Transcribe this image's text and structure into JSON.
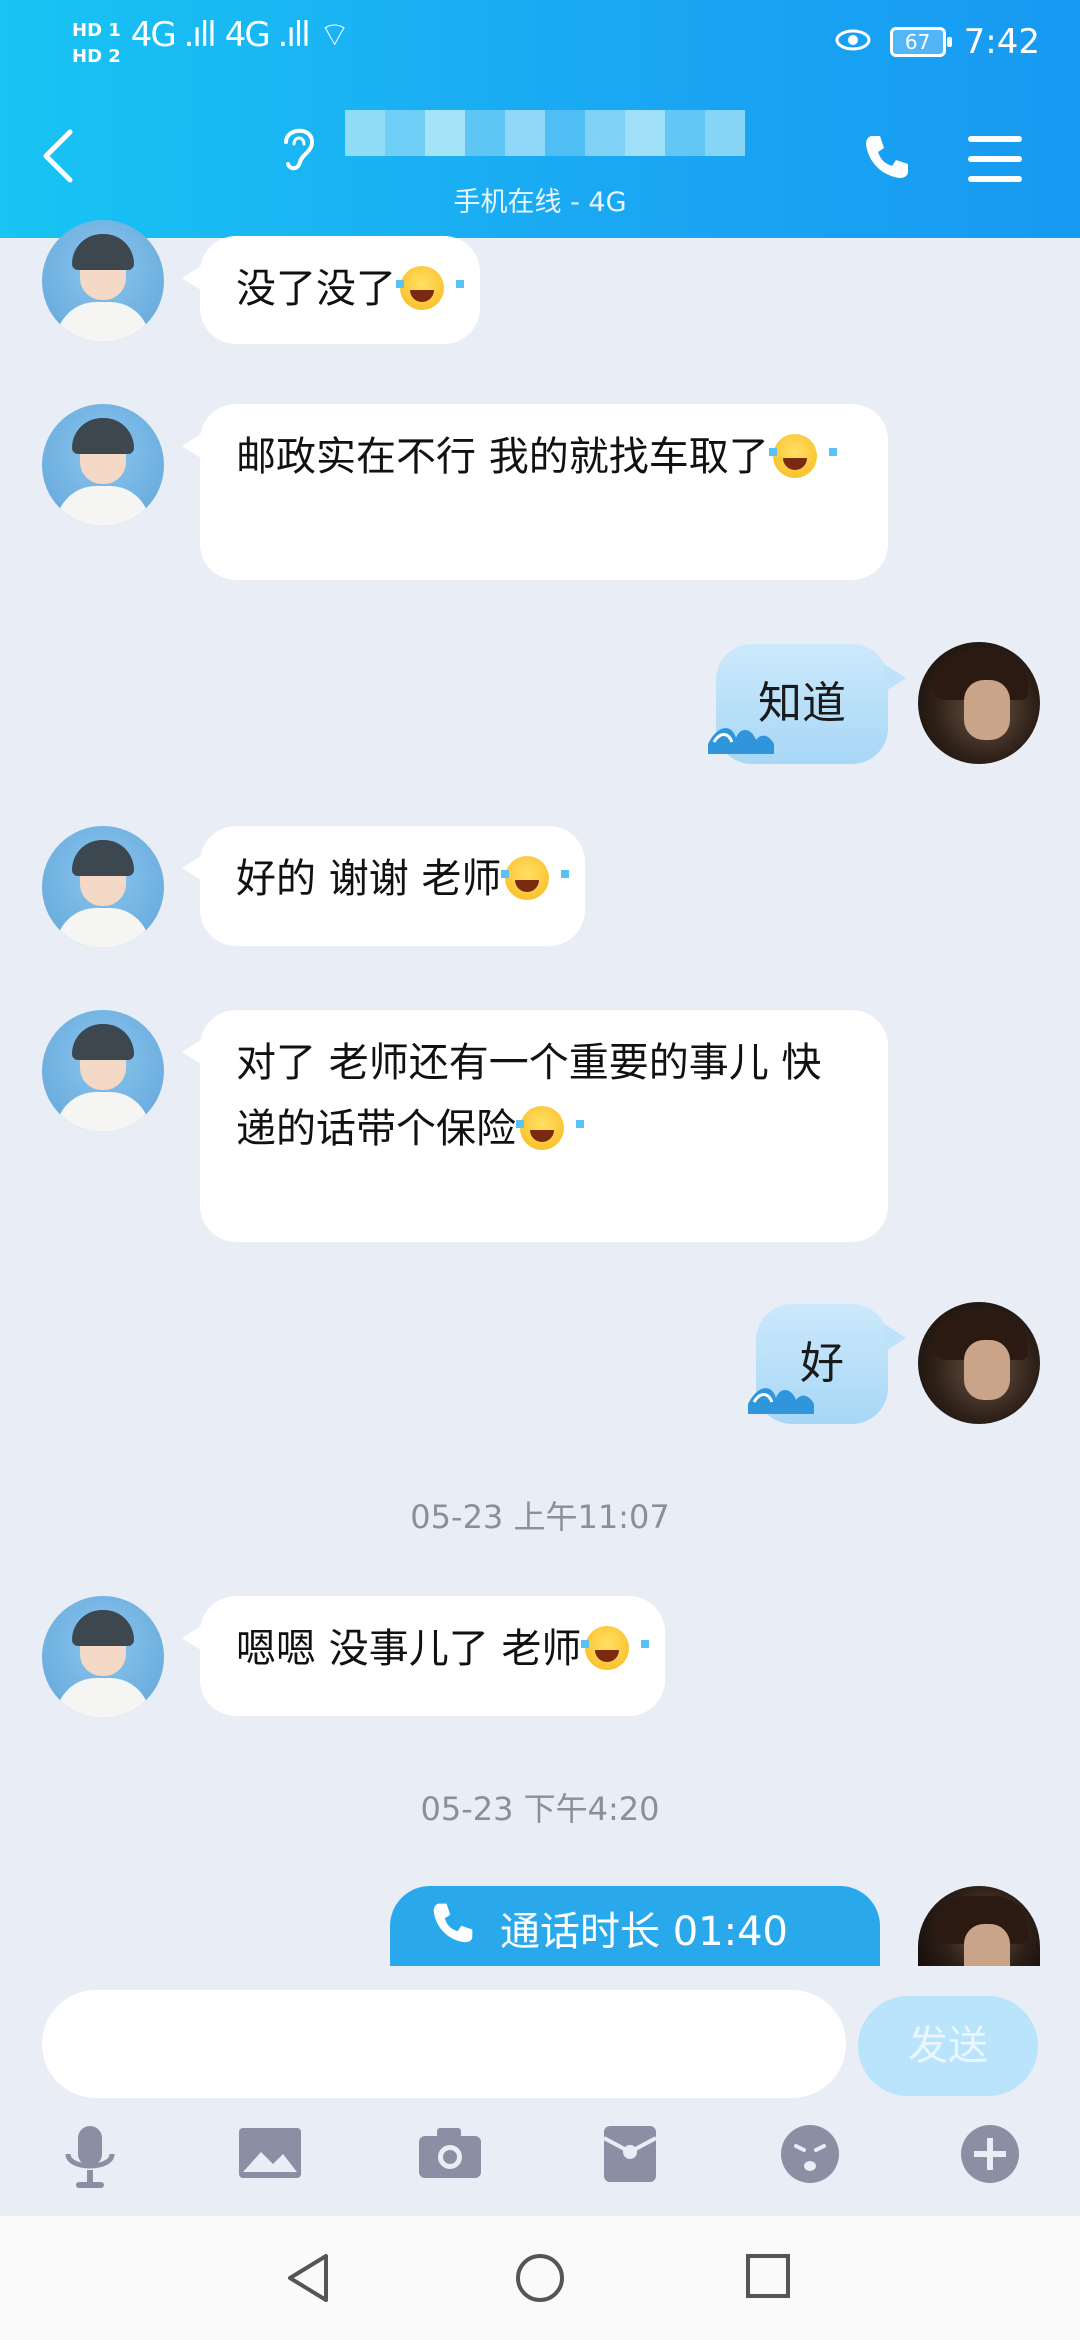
{
  "status_bar": {
    "hd1": "HD 1",
    "hd2": "HD 2",
    "net1": "4G .ıll",
    "net2": "4G .ıll",
    "wifi": "⌔",
    "battery": "67",
    "time": "7:42"
  },
  "header": {
    "subtitle": "手机在线 - 4G"
  },
  "messages": [
    {
      "text": "没了没了"
    },
    {
      "text": "邮政实在不行 我的就找车取了"
    },
    {
      "text": "知道"
    },
    {
      "text": "好的  谢谢 老师"
    },
    {
      "text": "对了 老师还有一个重要的事儿  快递的话带个保险"
    },
    {
      "text": "好"
    },
    {
      "text": "嗯嗯 没事儿了 老师"
    }
  ],
  "timestamps": [
    "05-23 上午11:07",
    "05-23 下午4:20"
  ],
  "call": {
    "text": "通话时长 01:40"
  },
  "input": {
    "placeholder": "",
    "send_label": "发送"
  },
  "icons": {
    "back": "back-icon",
    "ear": "ear-icon",
    "phone": "phone-icon",
    "menu": "menu-icon",
    "mic": "microphone-icon",
    "image": "image-icon",
    "camera": "camera-icon",
    "red_packet": "red-packet-icon",
    "emoji": "emoji-icon",
    "plus": "plus-icon"
  },
  "colors": {
    "header": "#18c4f3",
    "call_bubble": "#29a8ec",
    "send_button": "#b9e4fb"
  }
}
